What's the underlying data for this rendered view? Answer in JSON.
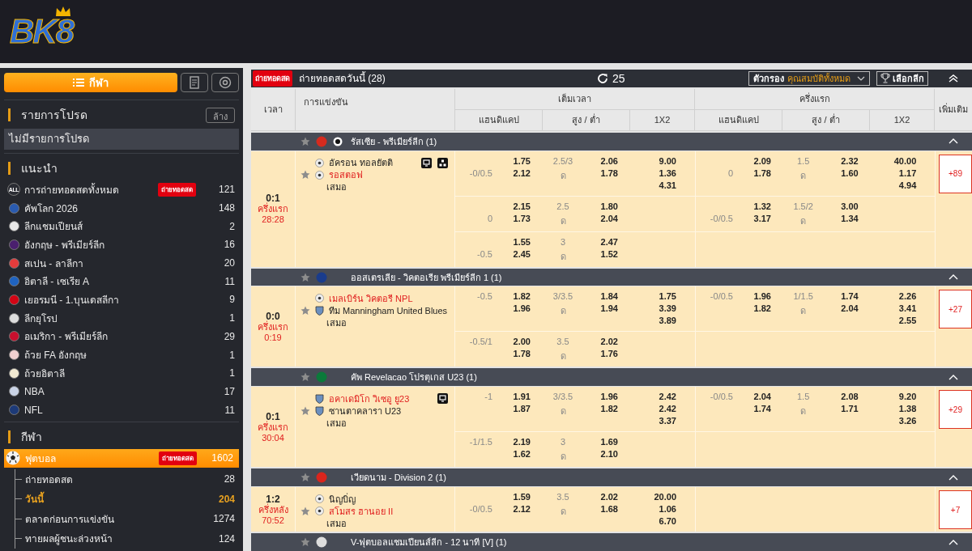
{
  "header": {
    "logo": "BK8"
  },
  "sidebar": {
    "sports_button": "กีฬา",
    "favorites": {
      "title": "รายการโปรด",
      "clear_button": "ล้าง",
      "empty_text": "ไม่มีรายการโปรด"
    },
    "recommended": {
      "title": "แนะนำ",
      "items": [
        {
          "label": "การถ่ายทอดสดทั้งหมด",
          "icon_text": "ALL",
          "badge": "ถ่ายทอดสด",
          "count": "121",
          "color": "#2a2c33"
        },
        {
          "label": "คัพโลก 2026",
          "count": "148",
          "color": "#2a5bb0"
        },
        {
          "label": "ลีกแชมเปียนส์",
          "count": "2",
          "color": "#e8e8e8"
        },
        {
          "label": "อังกฤษ - พรีเมียร์ลีก",
          "count": "16",
          "color": "#4a1f6e"
        },
        {
          "label": "สเปน - ลาลีกา",
          "count": "20",
          "color": "#e43c3c"
        },
        {
          "label": "อิตาลี - เซเรีย A",
          "count": "11",
          "color": "#1f63c0"
        },
        {
          "label": "เยอรมนี - 1.บุนเดสลีกา",
          "count": "9",
          "color": "#d20515"
        },
        {
          "label": "ลีกยุโรป",
          "count": "1",
          "color": "#dddddd"
        },
        {
          "label": "อเมริกา - พรีเมียร์ลีก",
          "count": "29",
          "color": "#c8102e"
        },
        {
          "label": "ถ้วย FA อังกฤษ",
          "count": "1",
          "color": "#f0d0d0"
        },
        {
          "label": "ถ้วยอิตาลี",
          "count": "1",
          "color": "#f2ead2"
        },
        {
          "label": "NBA",
          "count": "17",
          "color": "#c9d3e6"
        },
        {
          "label": "NFL",
          "count": "11",
          "color": "#1d3a78"
        }
      ]
    },
    "sports": {
      "title": "กีฬา",
      "items": [
        {
          "label": "ฟุตบอล",
          "badge": "ถ่ายทอดสด",
          "count": "1602",
          "selected": true,
          "children": [
            {
              "label": "ถ่ายทอดสด",
              "count": "28",
              "selected": false
            },
            {
              "label": "วันนี้",
              "count": "204",
              "selected": true
            },
            {
              "label": "ตลาดก่อนการแข่งขัน",
              "count": "1274",
              "selected": false
            },
            {
              "label": "ทายผลผู้ชนะล่วงหน้า",
              "count": "124",
              "selected": false
            }
          ]
        }
      ]
    }
  },
  "main": {
    "live_badge": "ถ่ายทอดสด",
    "title": "ถ่ายทอดสดวันนี้ (28)",
    "refresh_count": "25",
    "filter": {
      "label": "ตัวกรอง",
      "value": "คุณสมบัติทั้งหมด"
    },
    "league_button": "เลือกลีก",
    "table": {
      "columns": {
        "time": "เวลา",
        "match": "การแข่งขัน",
        "full_time": "เต็มเวลา",
        "first_half": "ครึ่งแรก",
        "more": "เพิ่มเติม",
        "markets": [
          "แฮนดิแคป",
          "สูง / ต่ำ",
          "1X2",
          "แฮนดิแคป",
          "สูง / ต่ำ",
          "1X2"
        ]
      },
      "leagues": [
        {
          "name": "รัสเซีย - พรีเมียร์ลีก (1)",
          "favorite": false,
          "color": "#d52b1e",
          "club_icon": true,
          "matches": [
            {
              "score": "0:1",
              "period": "ครึ่งแรก",
              "clock": "28:28",
              "favorite": false,
              "stream": true,
              "stats": true,
              "draw_label": "เสมอ",
              "more": "+89",
              "teams": [
                {
                  "name": "อัครอน ทอลยัตติ",
                  "highlight": false,
                  "kind": "ball"
                },
                {
                  "name": "รอสตอฟ",
                  "highlight": true,
                  "kind": "ball"
                }
              ],
              "lines": [
                {
                  "full_time": {
                    "handicap": {
                      "home": {
                        "odds": "1.75"
                      },
                      "away": {
                        "line": "-0/0.5",
                        "odds": "2.12"
                      }
                    },
                    "over_under": {
                      "line": "2.5/3",
                      "under_label": "ด",
                      "over": "2.06",
                      "under": "1.78"
                    },
                    "x12": [
                      "9.00",
                      "1.36",
                      "4.31"
                    ]
                  },
                  "first_half": {
                    "handicap": {
                      "home": {
                        "odds": "2.09"
                      },
                      "away": {
                        "line": "0",
                        "odds": "1.78"
                      }
                    },
                    "over_under": {
                      "line": "1.5",
                      "under_label": "ด",
                      "over": "2.32",
                      "under": "1.60"
                    },
                    "x12": [
                      "40.00",
                      "1.17",
                      "4.94"
                    ]
                  }
                },
                {
                  "full_time": {
                    "handicap": {
                      "home": {
                        "odds": "2.15"
                      },
                      "away": {
                        "line": "0",
                        "odds": "1.73"
                      }
                    },
                    "over_under": {
                      "line": "2.5",
                      "under_label": "ด",
                      "over": "1.80",
                      "under": "2.04"
                    }
                  },
                  "first_half": {
                    "handicap": {
                      "home": {
                        "odds": "1.32"
                      },
                      "away": {
                        "line": "-0/0.5",
                        "odds": "3.17"
                      }
                    },
                    "over_under": {
                      "line": "1.5/2",
                      "under_label": "ด",
                      "over": "3.00",
                      "under": "1.34"
                    }
                  }
                },
                {
                  "full_time": {
                    "handicap": {
                      "home": {
                        "odds": "1.55"
                      },
                      "away": {
                        "line": "-0.5",
                        "odds": "2.45"
                      }
                    },
                    "over_under": {
                      "line": "3",
                      "under_label": "ด",
                      "over": "2.47",
                      "under": "1.52"
                    }
                  }
                }
              ]
            }
          ]
        },
        {
          "name": "ออสเตรเลีย - วิคตอเรีย พรีเมียร์ลีก 1 (1)",
          "favorite": false,
          "color": "#1a3c8c",
          "matches": [
            {
              "score": "0:0",
              "period": "ครึ่งแรก",
              "clock": "0:19",
              "favorite": false,
              "stream": false,
              "stats": false,
              "draw_label": "เสมอ",
              "more": "+27",
              "teams": [
                {
                  "name": "เมลเบิร์น วิคตอรี NPL",
                  "highlight": true,
                  "kind": "ball"
                },
                {
                  "name": "ทีม Manningham United Blues",
                  "highlight": false,
                  "kind": "crest"
                }
              ],
              "lines": [
                {
                  "full_time": {
                    "handicap": {
                      "home": {
                        "line": "-0.5",
                        "odds": "1.82"
                      },
                      "away": {
                        "odds": "1.96"
                      }
                    },
                    "over_under": {
                      "line": "3/3.5",
                      "under_label": "ด",
                      "over": "1.84",
                      "under": "1.94"
                    },
                    "x12": [
                      "1.75",
                      "3.39",
                      "3.89"
                    ]
                  },
                  "first_half": {
                    "handicap": {
                      "home": {
                        "line": "-0/0.5",
                        "odds": "1.96"
                      },
                      "away": {
                        "odds": "1.82"
                      }
                    },
                    "over_under": {
                      "line": "1/1.5",
                      "under_label": "ด",
                      "over": "1.74",
                      "under": "2.04"
                    },
                    "x12": [
                      "2.26",
                      "3.41",
                      "2.55"
                    ]
                  }
                },
                {
                  "full_time": {
                    "handicap": {
                      "home": {
                        "line": "-0.5/1",
                        "odds": "2.00"
                      },
                      "away": {
                        "odds": "1.78"
                      }
                    },
                    "over_under": {
                      "line": "3.5",
                      "under_label": "ด",
                      "over": "2.02",
                      "under": "1.76"
                    }
                  }
                }
              ]
            }
          ]
        },
        {
          "name": "คัพ Revelacao โปรตุเกส U23 (1)",
          "favorite": false,
          "color": "#0b7a3a",
          "matches": [
            {
              "score": "0:1",
              "period": "ครึ่งแรก",
              "clock": "30:04",
              "favorite": false,
              "stream": true,
              "stats": false,
              "draw_label": "เสมอ",
              "more": "+29",
              "teams": [
                {
                  "name": "อคาเดมิโก วิเซอู ยู23",
                  "highlight": true,
                  "kind": "crest"
                },
                {
                  "name": "ซานตาคลารา U23",
                  "highlight": false,
                  "kind": "crest"
                }
              ],
              "lines": [
                {
                  "full_time": {
                    "handicap": {
                      "home": {
                        "line": "-1",
                        "odds": "1.91"
                      },
                      "away": {
                        "odds": "1.87"
                      }
                    },
                    "over_under": {
                      "line": "3/3.5",
                      "under_label": "ด",
                      "over": "1.96",
                      "under": "1.82"
                    },
                    "x12": [
                      "2.42",
                      "2.42",
                      "3.37"
                    ]
                  },
                  "first_half": {
                    "handicap": {
                      "home": {
                        "line": "-0/0.5",
                        "odds": "2.04"
                      },
                      "away": {
                        "odds": "1.74"
                      }
                    },
                    "over_under": {
                      "line": "1.5",
                      "under_label": "ด",
                      "over": "2.08",
                      "under": "1.71"
                    },
                    "x12": [
                      "9.20",
                      "1.38",
                      "3.26"
                    ]
                  }
                },
                {
                  "full_time": {
                    "handicap": {
                      "home": {
                        "line": "-1/1.5",
                        "odds": "2.19"
                      },
                      "away": {
                        "odds": "1.62"
                      }
                    },
                    "over_under": {
                      "line": "3",
                      "under_label": "ด",
                      "over": "1.69",
                      "under": "2.10"
                    }
                  }
                }
              ]
            }
          ]
        },
        {
          "name": "เวียดนาม - Division 2 (1)",
          "favorite": false,
          "color": "#da251d",
          "matches": [
            {
              "score": "1:2",
              "period": "ครึ่งหลัง",
              "clock": "70:52",
              "favorite": false,
              "stream": false,
              "stats": false,
              "draw_label": "เสมอ",
              "more": "+7",
              "teams": [
                {
                  "name": "นิญบิ่ญ",
                  "highlight": false,
                  "kind": "ball"
                },
                {
                  "name": "สโมสร ฮานอย II",
                  "highlight": true,
                  "kind": "ball"
                }
              ],
              "lines": [
                {
                  "full_time": {
                    "handicap": {
                      "home": {
                        "odds": "1.59"
                      },
                      "away": {
                        "line": "-0/0.5",
                        "odds": "2.12"
                      }
                    },
                    "over_under": {
                      "line": "3.5",
                      "under_label": "ด",
                      "over": "2.02",
                      "under": "1.68"
                    },
                    "x12": [
                      "20.00",
                      "1.06",
                      "6.70"
                    ]
                  }
                }
              ]
            }
          ]
        },
        {
          "name": "V-ฟุตบอลแชมเปียนส์ลีก - 12 นาที [V] (1)",
          "favorite": false,
          "color": "#dddddd"
        }
      ]
    }
  }
}
